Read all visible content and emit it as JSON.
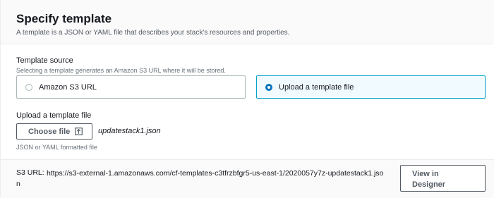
{
  "header": {
    "title": "Specify template",
    "subtitle": "A template is a JSON or YAML file that describes your stack's resources and properties."
  },
  "template_source": {
    "label": "Template source",
    "description": "Selecting a template generates an Amazon S3 URL where it will be stored.",
    "options": [
      {
        "label": "Amazon S3 URL",
        "selected": false
      },
      {
        "label": "Upload a template file",
        "selected": true
      }
    ]
  },
  "upload": {
    "label": "Upload a template file",
    "button_label": "Choose file",
    "file_name": "updatestack1.json",
    "hint": "JSON or YAML formatted file"
  },
  "s3": {
    "label": "S3 URL:",
    "url_line1": "https://s3-external-1.amazonaws.com/cf-templates-c3tfrzbfgr5-us-east-1/2020057y7z-updatestack1.jso",
    "url_line2": "n",
    "view_button_line1": "View in",
    "view_button_line2": "Designer"
  },
  "colors": {
    "accent": "#0073bb",
    "selected_bg": "#f1faff",
    "selected_border": "#00a1c9",
    "header_bg": "#fafafa"
  }
}
